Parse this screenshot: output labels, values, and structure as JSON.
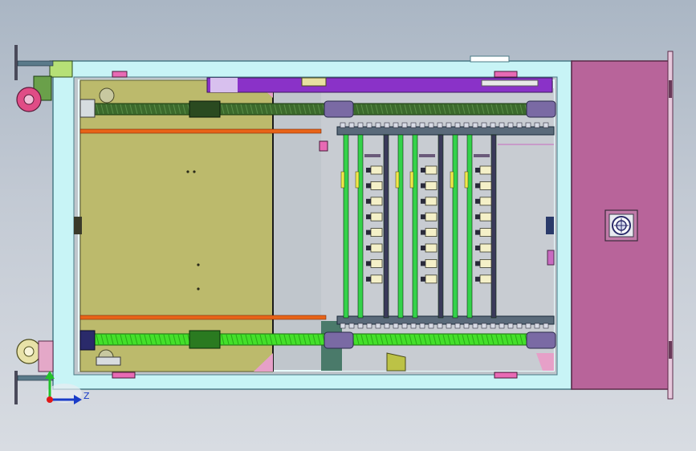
{
  "viewport": {
    "axis_label": "Z"
  },
  "colors": {
    "background_top": "#aab6c4",
    "background_bottom": "#d8dce2",
    "frame": "#c8f4f6",
    "frame_stroke": "#4a7a86",
    "door_panel": "#b8649a",
    "olive_panel": "#bcba6c",
    "screw_green": "#3c6a2c",
    "bright_green": "#44e02a",
    "purple_block": "#8a32c8",
    "rod_orange": "#e86418",
    "cylinder_purple": "#7a6aa4",
    "rail_green": "#34d24a",
    "rail_dark": "#3a3a5a",
    "axis_z": "#1a3cc8",
    "axis_y": "#22c22a",
    "axis_origin": "#e01818",
    "bracket_pink": "#e86ab4"
  },
  "drawing": {
    "description_free": true,
    "rail_count": 12,
    "slot_rows": 8
  }
}
